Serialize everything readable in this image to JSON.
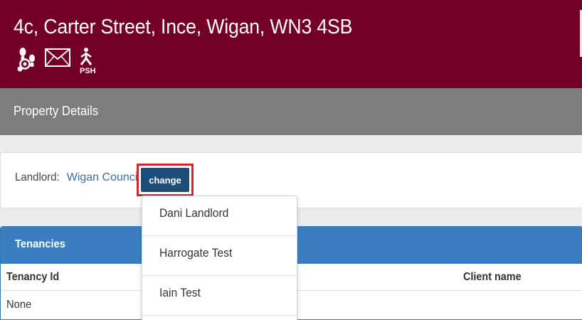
{
  "header": {
    "address": "4c, Carter Street, Ince, Wigan, WN3 4SB",
    "background": "#740028",
    "icons": [
      {
        "name": "footprints-icon"
      },
      {
        "name": "envelope-icon"
      },
      {
        "name": "psh-walking-person-icon",
        "caption": "PSH"
      }
    ]
  },
  "section": {
    "title": "Property Details"
  },
  "landlord": {
    "label": "Landlord:",
    "value": "Wigan Council",
    "change_label": "change"
  },
  "dropdown": {
    "items": [
      "Dani Landlord",
      "Harrogate Test",
      "Iain Test"
    ]
  },
  "tenancies": {
    "title": "Tenancies",
    "columns": [
      "Tenancy Id",
      "Client name"
    ],
    "rows": [
      [
        "None"
      ]
    ]
  },
  "colors": {
    "accent": "#740028",
    "section_bar": "#7d7d7d",
    "panel_header": "#3a7ebf",
    "button": "#1e4d77",
    "highlight": "#d4262f",
    "link": "#3b6ea5"
  }
}
